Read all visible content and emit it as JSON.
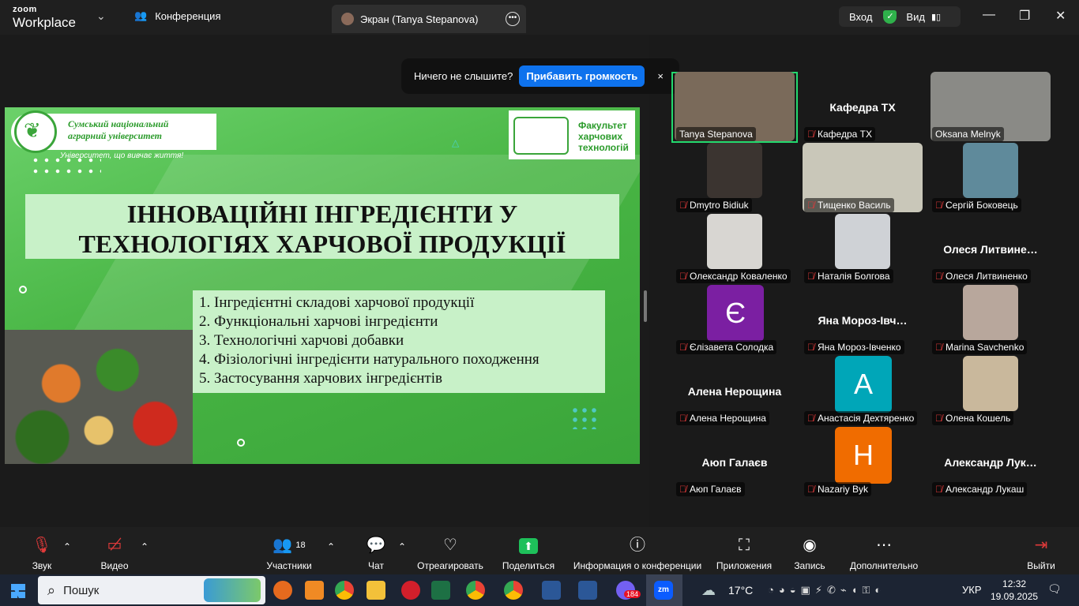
{
  "titlebar": {
    "brand_top": "zoom",
    "brand_bottom": "Workplace",
    "conference_tab": "Конференция",
    "screen_tab": "Экран (Tanya Stepanova)",
    "login_label": "Вход",
    "view_label": "Вид"
  },
  "toast": {
    "text": "Ничего не слышите?",
    "button": "Прибавить громкость",
    "close": "×"
  },
  "slide": {
    "uni_line1": "Сумський національний",
    "uni_line2": "аграрний університет",
    "tagline": "Університет, що вивчає життя!",
    "faculty_line1": "Факультет",
    "faculty_line2": "харчових",
    "faculty_line3": "технологій",
    "title_line1": "ІННОВАЦІЙНІ ІНГРЕДІЄНТИ У",
    "title_line2": "ТЕХНОЛОГІЯХ ХАРЧОВОЇ ПРОДУКЦІЇ",
    "items": [
      "1. Інгредієнтні складові харчової продукції",
      "2. Функціональні харчові інгредієнти",
      "3. Технологічні харчові добавки",
      "4. Фізіологічні інгредієнти натурального походження",
      "5. Застосування харчових інгредієнтів"
    ]
  },
  "participants": [
    {
      "label": "Tanya Stepanova",
      "big": "",
      "video": true,
      "color": "#7a6a5a",
      "muted": false
    },
    {
      "label": "Кафедра ТХ",
      "big": "Кафедра ТХ",
      "video": false,
      "color": "",
      "muted": true
    },
    {
      "label": "Oksana Melnyk",
      "big": "",
      "video": true,
      "color": "#8a8a86",
      "muted": false
    },
    {
      "label": "Dmytro Bidiuk",
      "big": "",
      "video": true,
      "color": "#3b3430",
      "muted": true
    },
    {
      "label": "Тищенко Василь",
      "big": "",
      "video": true,
      "color": "#c9c7b9",
      "muted": true
    },
    {
      "label": "Сергій Боковець",
      "big": "",
      "video": true,
      "color": "#5f8a9b",
      "muted": true
    },
    {
      "label": "Олександр Коваленко",
      "big": "",
      "video": true,
      "color": "#d8d6d2",
      "muted": true
    },
    {
      "label": "Наталія Болгова",
      "big": "",
      "video": true,
      "color": "#cfd2d6",
      "muted": true
    },
    {
      "label": "Олеся Литвиненко",
      "big": "Олеся  Литвине…",
      "video": false,
      "color": "",
      "muted": true
    },
    {
      "label": "Єлізавета Солодка",
      "big": "",
      "video": false,
      "letter": "Є",
      "color": "#7b1fa2",
      "muted": true
    },
    {
      "label": "Яна Мороз-Івченко",
      "big": "Яна  Мороз-Івч…",
      "video": false,
      "color": "",
      "muted": true
    },
    {
      "label": "Marina Savchenko",
      "big": "",
      "video": true,
      "color": "#b8a79c",
      "muted": true
    },
    {
      "label": "Алена Нерощина",
      "big": "Алена Нерощина",
      "video": false,
      "color": "",
      "muted": true
    },
    {
      "label": "Анастасія Дехтяренко",
      "big": "",
      "video": false,
      "letter": "A",
      "color": "#00a6b8",
      "muted": true
    },
    {
      "label": "Олена Кошель",
      "big": "",
      "video": true,
      "color": "#c9b89c",
      "muted": true
    },
    {
      "label": "Аюп Галаєв",
      "big": "Аюп Галаєв",
      "video": false,
      "color": "",
      "muted": true
    },
    {
      "label": "Nazariy Byk",
      "big": "",
      "video": false,
      "letter": "H",
      "color": "#f06c00",
      "muted": true
    },
    {
      "label": "Александр Лукаш",
      "big": "Александр  Лук…",
      "video": false,
      "color": "",
      "muted": true
    }
  ],
  "toolbar": {
    "audio": "Звук",
    "video": "Видео",
    "participants": "Участники",
    "participants_count": "18",
    "chat": "Чат",
    "react": "Отреагировать",
    "share": "Поделиться",
    "info": "Информация о конференции",
    "apps": "Приложения",
    "record": "Запись",
    "more": "Дополнительно",
    "leave": "Выйти"
  },
  "taskbar": {
    "search": "Пошук",
    "temperature": "17°C",
    "language": "УКР",
    "time": "12:32",
    "date": "19.09.2025",
    "badge_viber": "184"
  }
}
